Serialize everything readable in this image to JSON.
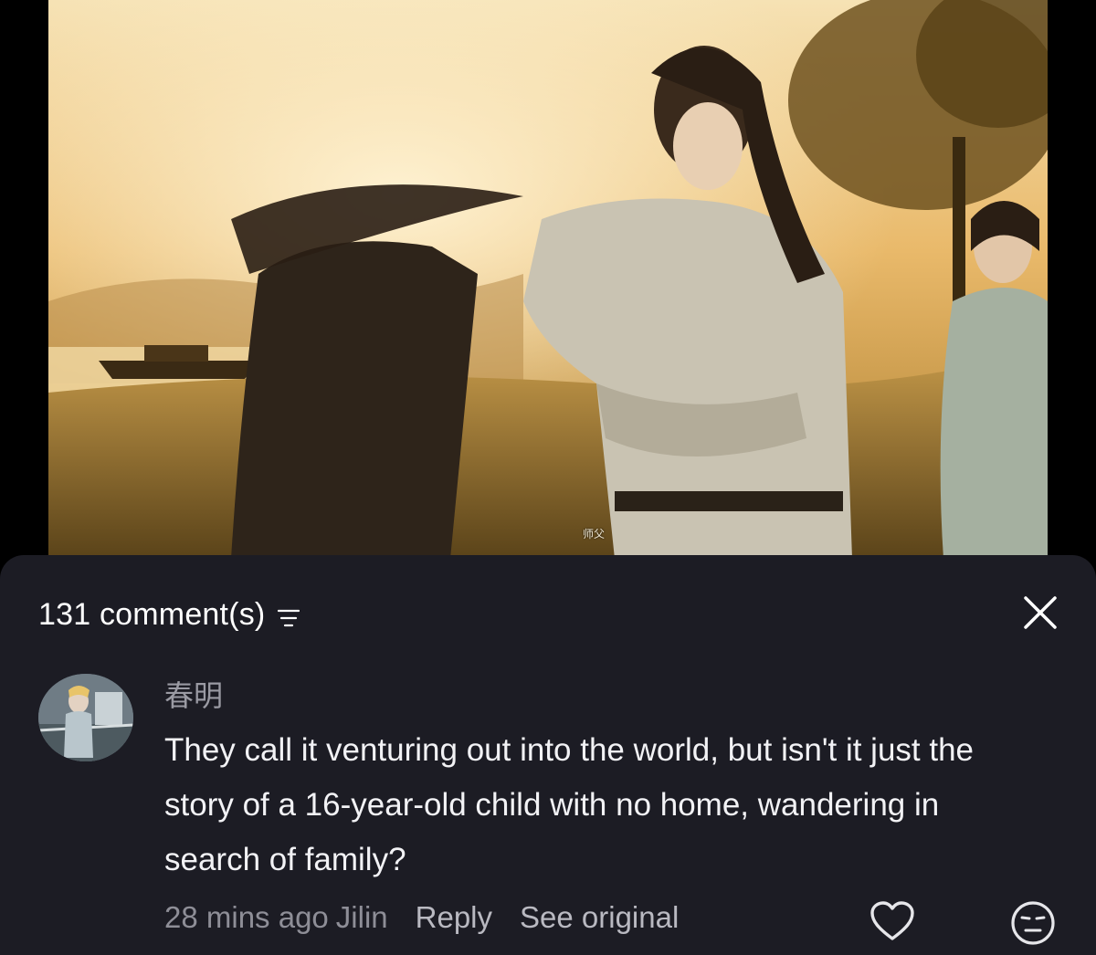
{
  "video": {
    "subtitle": "师父"
  },
  "comments_panel": {
    "count_label": "131 comment(s)",
    "icons": {
      "sort": "sort-icon",
      "close": "close-icon"
    }
  },
  "comment": {
    "username": "春明",
    "text": "They call it venturing out into the world, but isn't it just the story of a 16-year-old child with no home, wandering in search of family?",
    "time": "28 mins ago",
    "location": "Jilin",
    "reply_label": "Reply",
    "see_original_label": "See original",
    "icons": {
      "like": "heart-icon",
      "react": "emoji-icon"
    }
  },
  "colors": {
    "sheet_background": "#1c1c24",
    "primary_text": "#f2f2f5",
    "secondary_text": "#8e8e97",
    "action_text": "#b9b9c1"
  }
}
